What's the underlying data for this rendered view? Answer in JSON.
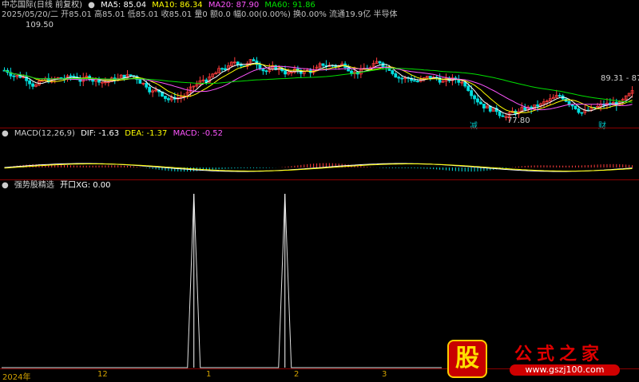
{
  "main_panel": {
    "title": "中芯国际(日线 前复权)",
    "ma_indicators": [
      {
        "label": "MA5: 85.04",
        "color": "#ffffff"
      },
      {
        "label": "MA10: 86.34",
        "color": "#ffff00"
      },
      {
        "label": "MA20: 87.90",
        "color": "#ff55ff"
      },
      {
        "label": "MA60: 91.86",
        "color": "#00e000"
      }
    ],
    "quote_line": "2025/05/20/二 开85.01 高85.01 低85.01 收85.01 量0 额0.0 幅0.00(0.00%) 换0.00% 流通19.9亿 半导体",
    "high_label": "109.50",
    "low_label": "77.80",
    "right_label": "89.31 - 87.",
    "event_markers": [
      "减",
      "财"
    ]
  },
  "macd_panel": {
    "title": "MACD(12,26,9)",
    "dif": "DIF: -1.63",
    "dea": "DEA: -1.37",
    "macd": "MACD: -0.52"
  },
  "indicator_panel": {
    "title": "强势股精选",
    "xg_label": "开口XG: 0.00",
    "chart_data": {
      "type": "line",
      "title": "",
      "xlabel": "",
      "ylabel": "",
      "signal_bars": [
        77,
        114
      ],
      "values": [
        0,
        1
      ]
    }
  },
  "time_axis": {
    "labels": [
      "2024年",
      "12",
      "1",
      "2",
      "3"
    ]
  },
  "watermark": {
    "logo_char": "股",
    "site_name": "公式之家",
    "url": "www.gszj100.com"
  }
}
